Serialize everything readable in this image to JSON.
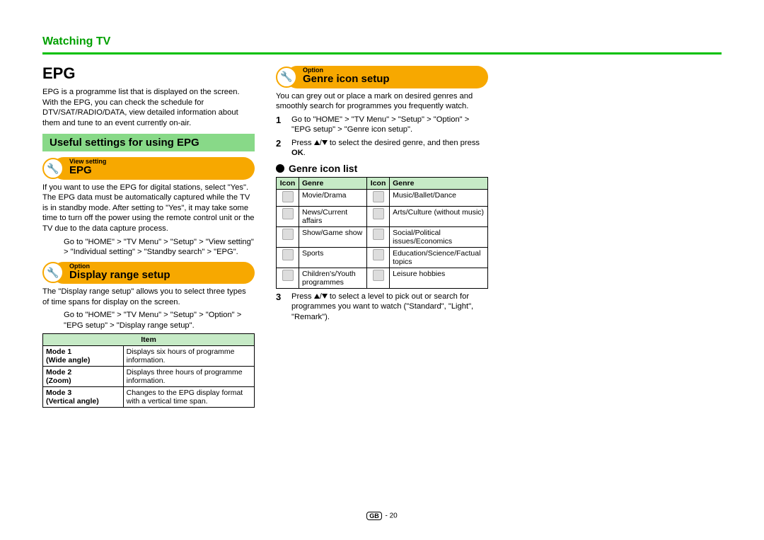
{
  "header": "Watching TV",
  "main_title": "EPG",
  "intro": "EPG is a programme list that is displayed on the screen. With the EPG, you can check the schedule for DTV/SAT/RADIO/DATA, view detailed information about them and tune to an event currently on-air.",
  "useful_settings": "Useful settings for using EPG",
  "pill1_sup": "View setting",
  "pill1_title": "EPG",
  "epg_desc": "If you want to use the EPG for digital stations, select \"Yes\". The EPG data must be automatically captured while the TV is in standby mode. After setting to \"Yes\", it may take some time to turn off the power using the remote control unit or the TV due to the data capture process.",
  "epg_path": "Go to \"HOME\" > \"TV Menu\" > \"Setup\" > \"View setting\" > \"Individual setting\" > \"Standby search\" > \"EPG\".",
  "pill2_sup": "Option",
  "pill2_title": "Display range setup",
  "display_range_desc": "The \"Display range setup\" allows you to select three types of time spans for display on the screen.",
  "display_range_path": "Go to \"HOME\" > \"TV Menu\" > \"Setup\" > \"Option\" > \"EPG setup\" > \"Display range setup\".",
  "table1_header": "Item",
  "table1": [
    {
      "mode_a": "Mode 1",
      "mode_b": "(Wide angle)",
      "desc": "Displays six hours of programme information."
    },
    {
      "mode_a": "Mode 2",
      "mode_b": "(Zoom)",
      "desc": "Displays three hours of programme information."
    },
    {
      "mode_a": "Mode 3",
      "mode_b": "(Vertical angle)",
      "desc": "Changes to the EPG display format with a vertical time span."
    }
  ],
  "pill3_sup": "Option",
  "pill3_title": "Genre icon setup",
  "genre_desc": "You can grey out or place a mark on desired genres and smoothly search for programmes you frequently watch.",
  "step1": "Go to \"HOME\" > \"TV Menu\" > \"Setup\" > \"Option\" > \"EPG setup\" > \"Genre icon setup\".",
  "step2a": "Press ",
  "step2b": " to select the desired genre, and then press ",
  "ok": "OK",
  "period": ".",
  "genre_list_title": "Genre icon list",
  "th_icon": "Icon",
  "th_genre": "Genre",
  "genres": [
    {
      "l": "Movie/Drama",
      "r": "Music/Ballet/Dance"
    },
    {
      "l": "News/Current affairs",
      "r": "Arts/Culture (without music)"
    },
    {
      "l": "Show/Game show",
      "r": "Social/Political issues/Economics"
    },
    {
      "l": "Sports",
      "r": "Education/Science/Factual topics"
    },
    {
      "l": "Children's/Youth programmes",
      "r": "Leisure hobbies"
    }
  ],
  "step3a": "Press ",
  "step3b": " to select a level to pick out or search for programmes you want to watch (\"Standard\", \"Light\", \"Remark\").",
  "pagenum": " - 20",
  "gb": "GB",
  "wrench": "🔧"
}
